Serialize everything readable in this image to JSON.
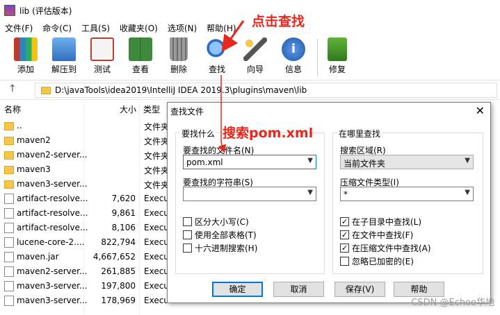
{
  "window": {
    "title": "lib (评估版本)"
  },
  "menu": [
    "文件(F)",
    "命令(C)",
    "工具(S)",
    "收藏夹(O)",
    "选项(N)",
    "帮助(H)"
  ],
  "toolbar": [
    {
      "label": "添加",
      "icon": "books-add-icon",
      "color": "#c0392b"
    },
    {
      "label": "解压到",
      "icon": "folder-extract-icon",
      "color": "#3a78c8"
    },
    {
      "label": "测试",
      "icon": "clipboard-test-icon",
      "color": "#b74030"
    },
    {
      "label": "查看",
      "icon": "book-view-icon",
      "color": "#3d8a3d"
    },
    {
      "label": "删除",
      "icon": "trash-icon",
      "color": "#8a8a8a"
    },
    {
      "label": "查找",
      "icon": "magnifier-icon",
      "color": "#2b6cc4"
    },
    {
      "label": "向导",
      "icon": "wand-icon",
      "color": "#6b6bd0"
    },
    {
      "label": "信息",
      "icon": "info-icon",
      "color": "#2060c0"
    },
    {
      "label": "修复",
      "icon": "repair-icon",
      "color": "#4b9a2b"
    }
  ],
  "address": {
    "path": "D:\\javaTools\\idea2019\\IntelliJ IDEA 2019.3\\plugins\\maven\\lib"
  },
  "filelist": {
    "headers": {
      "name": "名称",
      "size": "大小",
      "type": "类型"
    },
    "rows": [
      {
        "name": "..",
        "size": "",
        "type": "文件夹",
        "kind": "folder"
      },
      {
        "name": "maven2",
        "size": "",
        "type": "文件夹",
        "kind": "folder"
      },
      {
        "name": "maven2-server...",
        "size": "",
        "type": "文件夹",
        "kind": "folder"
      },
      {
        "name": "maven3",
        "size": "",
        "type": "文件夹",
        "kind": "folder"
      },
      {
        "name": "maven3-server...",
        "size": "",
        "type": "文件夹",
        "kind": "folder"
      },
      {
        "name": "artifact-resolve...",
        "size": "7,620",
        "type": "Execu",
        "kind": "file"
      },
      {
        "name": "artifact-resolve...",
        "size": "9,861",
        "type": "Execu",
        "kind": "file"
      },
      {
        "name": "artifact-resolve...",
        "size": "8,106",
        "type": "Execu",
        "kind": "file"
      },
      {
        "name": "lucene-core-2....",
        "size": "822,794",
        "type": "Execu",
        "kind": "file"
      },
      {
        "name": "maven.jar",
        "size": "4,667,652",
        "type": "Execu",
        "kind": "file"
      },
      {
        "name": "maven2-server...",
        "size": "261,885",
        "type": "Execu",
        "kind": "file"
      },
      {
        "name": "maven3-server...",
        "size": "197,800",
        "type": "Execu",
        "kind": "file"
      },
      {
        "name": "maven3-server...",
        "size": "178,969",
        "type": "Execu",
        "kind": "file"
      }
    ]
  },
  "dialog": {
    "title": "查找文件",
    "close": "✕",
    "left_group": "要找什么",
    "filename_label": "要查找的文件名(N)",
    "filename_value": "pom.xml",
    "string_label": "要查找的字符串(S)",
    "string_value": "",
    "left_checks": [
      {
        "label": "区分大小写(C)",
        "checked": false
      },
      {
        "label": "使用全部表格(T)",
        "checked": false
      },
      {
        "label": "十六进制搜索(H)",
        "checked": false
      }
    ],
    "right_group": "在哪里查找",
    "area_label": "搜索区域(R)",
    "area_value": "当前文件夹",
    "archive_label": "压缩文件类型(I)",
    "archive_value": "*",
    "right_checks": [
      {
        "label": "在子目录中查找(L)",
        "checked": true
      },
      {
        "label": "在文件中查找(F)",
        "checked": true
      },
      {
        "label": "在压缩文件中查找(A)",
        "checked": true
      },
      {
        "label": "忽略已加密的(E)",
        "checked": false
      }
    ],
    "buttons": {
      "ok": "确定",
      "cancel": "取消",
      "save": "保存(V)",
      "help": "帮助"
    }
  },
  "annotations": {
    "click_find": "点击查找",
    "search_pom": "搜索pom.xml"
  },
  "watermark": "CSDN @Echoo华地",
  "colors": {
    "annotation": "#e8281c",
    "focus": "#0078d7"
  }
}
